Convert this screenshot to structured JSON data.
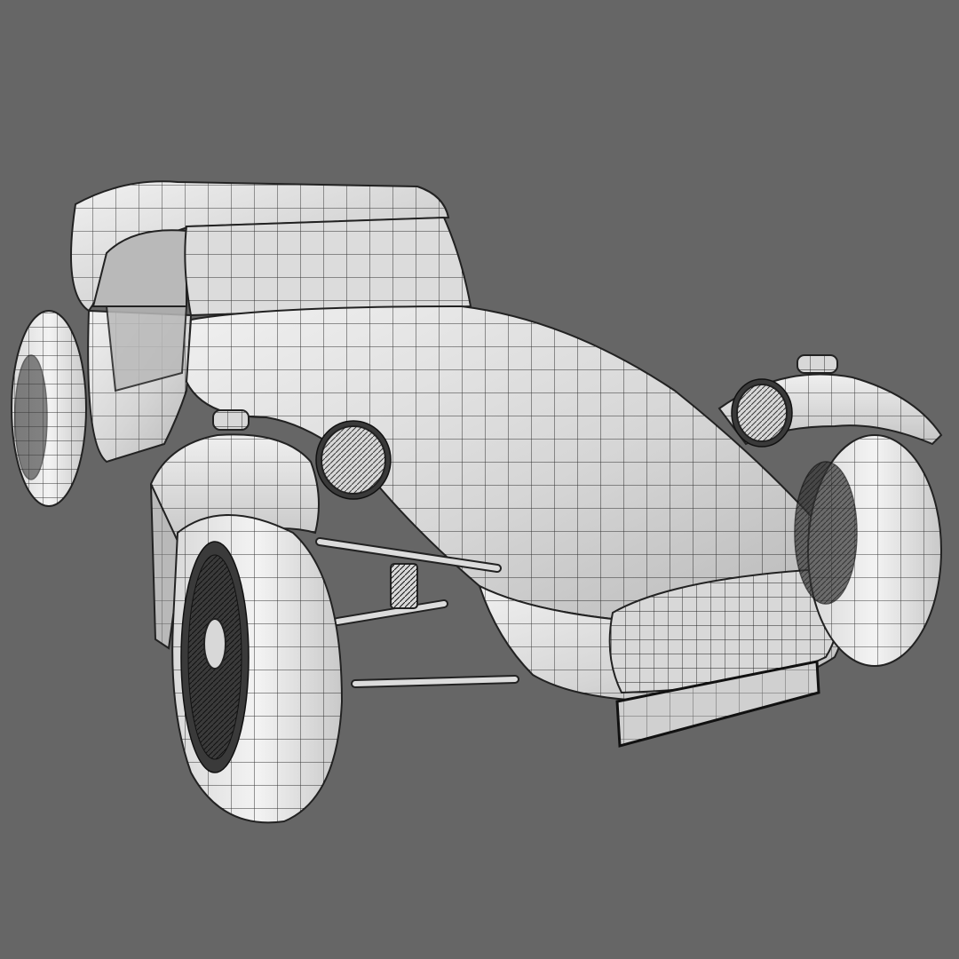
{
  "scene": {
    "background_color": "#666666",
    "surface_color": "#e8e8e8",
    "wire_color": "#1f1f1f",
    "subject": "wireframe-car"
  }
}
